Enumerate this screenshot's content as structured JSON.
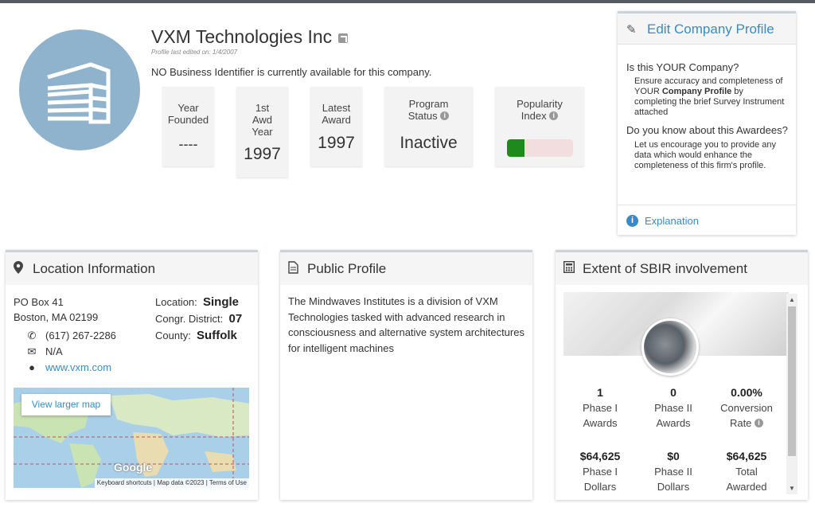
{
  "company": {
    "name": "VXM Technologies Inc",
    "edited": "Profile last edited on: 1/4/2007",
    "business_id_note": "NO Business Identifier is currently available for this company."
  },
  "stats": {
    "year_founded": {
      "label": "Year Founded",
      "value": "----"
    },
    "first_award": {
      "label_l1": "1st",
      "label_l2": "Awd",
      "label_l3": "Year",
      "value": "1997"
    },
    "latest_award": {
      "label": "Latest Award",
      "value": "1997"
    },
    "program_status": {
      "label_l1": "Program",
      "label_l2": "Status",
      "value": "Inactive"
    },
    "popularity": {
      "label_l1": "Popularity",
      "label_l2": "Index",
      "level": 0.27
    }
  },
  "edit_panel": {
    "title": "Edit Company Profile",
    "q1": "Is this YOUR Company?",
    "a1_pre": "Ensure accuracy and completeness of YOUR ",
    "a1_bold": "Company Profile",
    "a1_post": " by completing the brief Survey Instrument attached",
    "q2": "Do you know about this Awardees?",
    "a2": "Let us encourage you to provide any data which would enhance the completeness of this firm's profile.",
    "explanation": "Explanation"
  },
  "location": {
    "title": "Location Information",
    "address1": "PO Box 41",
    "address2": "Boston, MA 02199",
    "phone": "(617) 267-2286",
    "email": "N/A",
    "website": "www.vxm.com",
    "location_label": "Location:",
    "location_value": "Single",
    "district_label": "Congr. District:",
    "district_value": "07",
    "county_label": "County:",
    "county_value": "Suffolk",
    "map_button": "View larger map",
    "map_attribution": "Keyboard shortcuts | Map data ©2023 | Terms of Use",
    "map_logo": "Google"
  },
  "public_profile": {
    "title": "Public Profile",
    "text": "The Mindwaves Institutes is a division of VXM Technologies tasked with advanced research in consciousness and alternative system architectures for intelligent machines"
  },
  "sbir": {
    "title": "Extent of SBIR involvement",
    "phase1_awards_value": "1",
    "phase1_awards_l1": "Phase I",
    "phase1_awards_l2": "Awards",
    "phase2_awards_value": "0",
    "phase2_awards_l1": "Phase II",
    "phase2_awards_l2": "Awards",
    "conversion_value": "0.00%",
    "conversion_l1": "Conversion",
    "conversion_l2": "Rate",
    "phase1_dollars_value": "$64,625",
    "phase1_dollars_l1": "Phase I",
    "phase1_dollars_l2": "Dollars",
    "phase2_dollars_value": "$0",
    "phase2_dollars_l1": "Phase II",
    "phase2_dollars_l2": "Dollars",
    "total_value": "$64,625",
    "total_l1": "Total",
    "total_l2": "Awarded"
  },
  "colors": {
    "accent": "#3a8bc4",
    "logo_bg": "#8fb2cd",
    "popularity_fill": "#1e8a1e",
    "popularity_bg": "#f2dede"
  }
}
